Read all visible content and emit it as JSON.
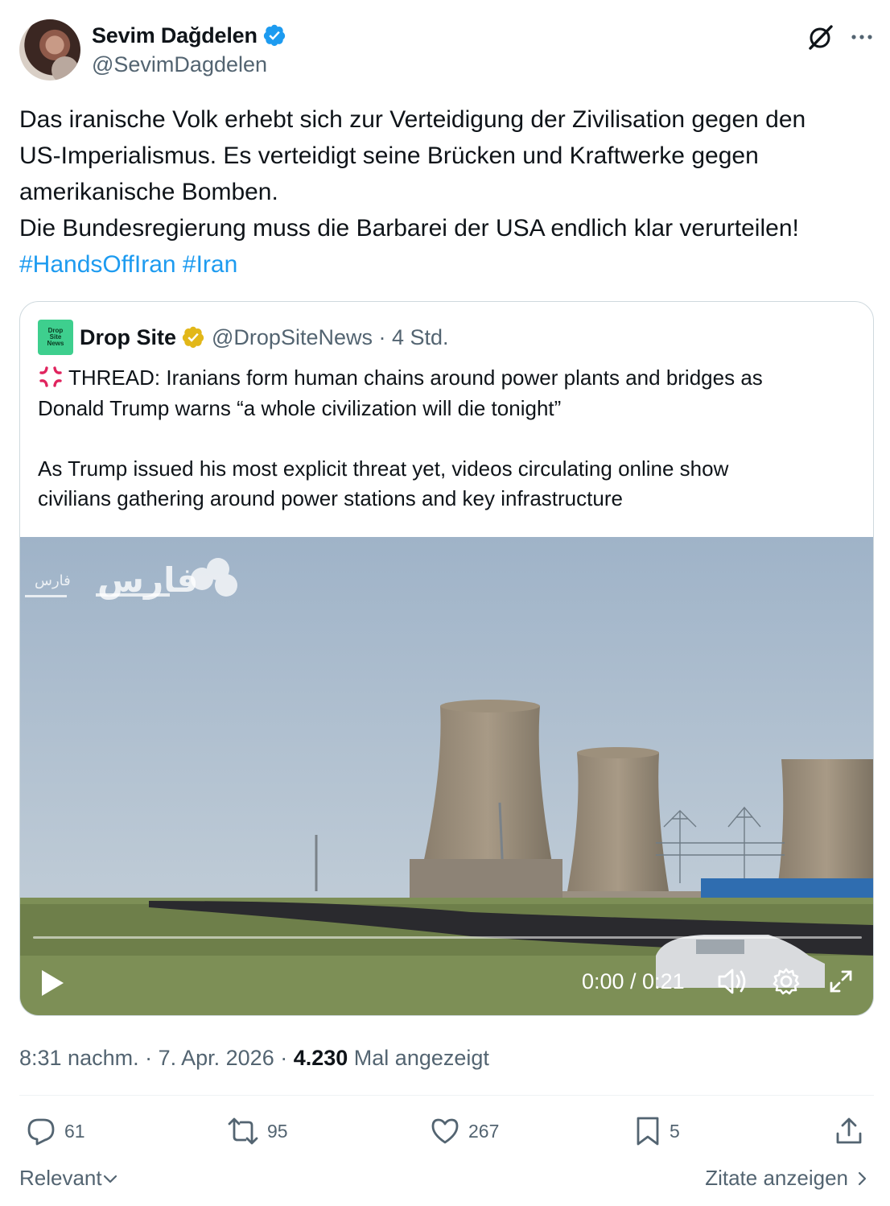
{
  "author": {
    "display_name": "Sevim Dağdelen",
    "handle": "@SevimDagdelen",
    "verified_badge_color": "#1d9bf0"
  },
  "tweet": {
    "lines": [
      "Das iranische Volk erhebt sich zur Verteidigung der Zivilisation gegen den",
      "US-Imperialismus. Es verteidigt seine Brücken und Kraftwerke gegen",
      "amerikanische Bomben.",
      "Die Bundesregierung muss die Barbarei der USA endlich klar verurteilen!"
    ],
    "hashtags": [
      "#HandsOffIran",
      "#Iran"
    ]
  },
  "quoted": {
    "avatar_text": "Drop Site News",
    "name": "Drop Site",
    "handle_time": "@DropSiteNews · 4 Std.",
    "verified_badge_color": "#e2b719",
    "lines": [
      "THREAD: Iranians form human chains around power plants and bridges as",
      "Donald Trump warns “a whole civilization will die tonight”",
      "As Trump issued his most explicit threat yet, videos circulating online show",
      "civilians gathering around power stations and key infrastructure"
    ],
    "video": {
      "watermark": "فارس",
      "watermark_small": "فارس",
      "time": "0:00 / 0:21",
      "progress": 0.0
    }
  },
  "meta": {
    "time_date": "8:31 nachm. · 7. Apr. 2026 · ",
    "views_count": "4.230",
    "views_label": " Mal angezeigt"
  },
  "actions": {
    "replies": "61",
    "reposts": "95",
    "likes": "267",
    "bookmarks": "5"
  },
  "footer": {
    "sort_label": "Relevant",
    "quotes_link": "Zitate anzeigen"
  },
  "icons": [
    "verified-icon",
    "grok-icon",
    "more-icon",
    "play-icon",
    "volume-icon",
    "settings-icon",
    "fullscreen-icon",
    "reply-icon",
    "repost-icon",
    "like-icon",
    "bookmark-icon",
    "share-icon",
    "chevron-down-icon",
    "chevron-right-icon"
  ]
}
